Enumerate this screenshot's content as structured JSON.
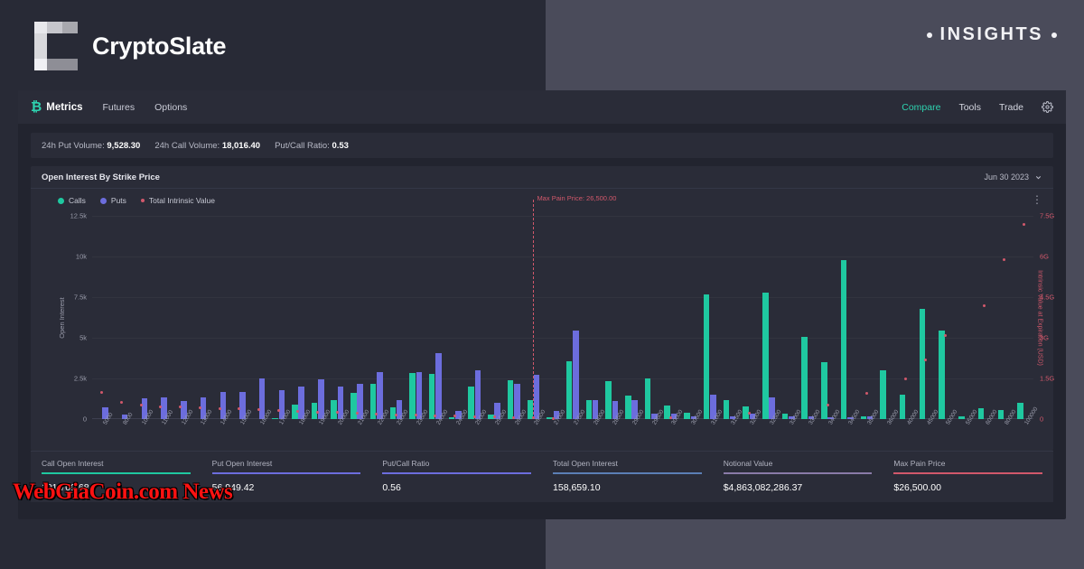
{
  "brand": {
    "name": "CryptoSlate",
    "logo_icon": "cryptoslate-c-logo",
    "insights_label": "INSIGHTS",
    "insights_dot_icon": "bullet-dot-icon"
  },
  "app_nav": {
    "logo_glyph": "₿",
    "logo_label": "Metrics",
    "items": [
      {
        "label": "Futures"
      },
      {
        "label": "Options"
      }
    ],
    "right_items": [
      {
        "label": "Compare",
        "accent": true
      },
      {
        "label": "Tools",
        "accent": false
      },
      {
        "label": "Trade",
        "accent": false
      }
    ],
    "gear_icon": "gear-icon"
  },
  "stats": [
    {
      "label": "24h Put Volume:",
      "value": "9,528.30"
    },
    {
      "label": "24h Call Volume:",
      "value": "18,016.40"
    },
    {
      "label": "Put/Call Ratio:",
      "value": "0.53"
    }
  ],
  "card": {
    "title": "Open Interest By Strike Price",
    "date_value": "Jun 30 2023",
    "chevron_icon": "chevron-down-icon",
    "menu_icon": "kebab-menu-icon"
  },
  "colors": {
    "calls": "#1fc8a0",
    "puts": "#6c6ddd",
    "intrinsic": "#d1586b",
    "panel": "#2a2c38",
    "app_bg": "#22242f"
  },
  "chart_data": {
    "type": "bar",
    "title": "Open Interest By Strike Price",
    "xlabel": "",
    "ylabel": "Open Interest",
    "y2label": "Intrinsic Value at Expiration (USD)",
    "ylim": [
      0,
      12500
    ],
    "y2lim": [
      0,
      7500000000
    ],
    "yticks": [
      "0",
      "2.5k",
      "5k",
      "7.5k",
      "10k",
      "12.5k"
    ],
    "y2ticks": [
      "0",
      "1.5G",
      "3G",
      "4.5G",
      "6G",
      "7.5G"
    ],
    "grid": true,
    "legend_position": "top-left",
    "annotation": {
      "label": "Max Pain Price: 26,500.00",
      "x_category": "26500",
      "color": "#d1586b"
    },
    "categories": [
      "5000",
      "8000",
      "10000",
      "11000",
      "12000",
      "13000",
      "14000",
      "15000",
      "16000",
      "17000",
      "18000",
      "19000",
      "20000",
      "21000",
      "22000",
      "23000",
      "23500",
      "24000",
      "24500",
      "25000",
      "25500",
      "26000",
      "26500",
      "27000",
      "27500",
      "28000",
      "28500",
      "29000",
      "29500",
      "30000",
      "30500",
      "31000",
      "31500",
      "32000",
      "32500",
      "33000",
      "33500",
      "34000",
      "34500",
      "35000",
      "36000",
      "40000",
      "45000",
      "50000",
      "55000",
      "60000",
      "80000",
      "100000"
    ],
    "series": [
      {
        "name": "Calls",
        "color": "#1fc8a0",
        "values": [
          0,
          0,
          0,
          0,
          0,
          0,
          0,
          0,
          0,
          60,
          900,
          980,
          1180,
          1600,
          2180,
          740,
          2850,
          2800,
          130,
          2020,
          300,
          2380,
          1180,
          100,
          3530,
          1180,
          2320,
          1420,
          2500,
          840,
          390,
          7650,
          1180,
          790,
          7800,
          330,
          5050,
          3480,
          9780,
          150,
          2980,
          1480,
          6800,
          5420,
          150,
          640,
          550,
          1000
        ]
      },
      {
        "name": "Puts",
        "color": "#6c6ddd",
        "values": [
          700,
          300,
          1260,
          1320,
          1130,
          1340,
          1680,
          1680,
          2480,
          1800,
          2020,
          2450,
          1980,
          2150,
          2870,
          1150,
          2870,
          4050,
          520,
          3000,
          1020,
          2150,
          2700,
          480,
          5420,
          1180,
          1130,
          1180,
          360,
          320,
          180,
          1480,
          150,
          330,
          1350,
          180,
          180,
          130,
          130,
          150,
          0,
          0,
          0,
          0,
          0,
          0,
          0,
          0
        ]
      }
    ],
    "intrinsic_points": [
      {
        "x": "5000",
        "y": 1.0
      },
      {
        "x": "8000",
        "y": 0.62
      },
      {
        "x": "10000",
        "y": 0.53
      },
      {
        "x": "11000",
        "y": 0.44
      },
      {
        "x": "12000",
        "y": 0.44
      },
      {
        "x": "13000",
        "y": 0.41
      },
      {
        "x": "14000",
        "y": 0.38
      },
      {
        "x": "15000",
        "y": 0.38
      },
      {
        "x": "16000",
        "y": 0.35
      },
      {
        "x": "17000",
        "y": 0.32
      },
      {
        "x": "18000",
        "y": 0.29
      },
      {
        "x": "19000",
        "y": 0.26
      },
      {
        "x": "20000",
        "y": 0.24
      },
      {
        "x": "21000",
        "y": 0.21
      },
      {
        "x": "22000",
        "y": 0.18
      },
      {
        "x": "23000",
        "y": 0.15
      },
      {
        "x": "23500",
        "y": 0.15
      },
      {
        "x": "24000",
        "y": 0.12
      },
      {
        "x": "24500",
        "y": 0.12
      },
      {
        "x": "25000",
        "y": 0.09
      },
      {
        "x": "25500",
        "y": 0.09
      },
      {
        "x": "26000",
        "y": 0.06
      },
      {
        "x": "26500",
        "y": 0.06
      },
      {
        "x": "27000",
        "y": 0.03
      },
      {
        "x": "30000",
        "y": 0.06
      },
      {
        "x": "32000",
        "y": 0.21
      },
      {
        "x": "34000",
        "y": 0.53
      },
      {
        "x": "35000",
        "y": 0.95
      },
      {
        "x": "40000",
        "y": 1.5
      },
      {
        "x": "45000",
        "y": 2.2
      },
      {
        "x": "50000",
        "y": 3.1
      },
      {
        "x": "60000",
        "y": 4.2
      },
      {
        "x": "80000",
        "y": 5.9
      },
      {
        "x": "100000",
        "y": 7.2
      }
    ],
    "legend": [
      {
        "label": "Calls",
        "color": "#1fc8a0"
      },
      {
        "label": "Puts",
        "color": "#6c6ddd"
      },
      {
        "label": "Total Intrinsic Value",
        "color": "#d1586b"
      }
    ]
  },
  "summary": [
    {
      "label": "Call Open Interest",
      "value": "101,709.68",
      "rule_color": "#1fc8a0"
    },
    {
      "label": "Put Open Interest",
      "value": "56,949.42",
      "rule_color": "#6c6ddd"
    },
    {
      "label": "Put/Call Ratio",
      "value": "0.56",
      "rule_color": "#6c6ddd"
    },
    {
      "label": "Total Open Interest",
      "value": "158,659.10",
      "rule_color": "#5b7fb5"
    },
    {
      "label": "Notional Value",
      "value": "$4,863,082,286.37",
      "rule_color": "#8a7ba8"
    },
    {
      "label": "Max Pain Price",
      "value": "$26,500.00",
      "rule_color": "#d1586b"
    }
  ],
  "watermark": {
    "text": "WebGiaCoin.com News"
  }
}
